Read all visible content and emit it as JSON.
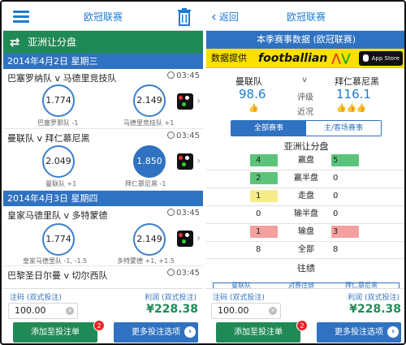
{
  "colors": {
    "brand_blue": "#2f72c1",
    "brand_green": "#208a56",
    "yellow": "#fbe000",
    "red_badge": "#e8262a"
  },
  "left": {
    "nav": {
      "title": "欧冠联赛",
      "menu_icon": "menu-icon",
      "trash_icon": "trash-icon"
    },
    "market": {
      "label": "亚洲让分盘",
      "icon": "swap-icon"
    },
    "dates": [
      "2014年4月2日 星期三",
      "2014年4月3日 星期四"
    ],
    "matches": [
      {
        "name": "巴塞罗纳队 v 马德里竞技队",
        "time": "03:45",
        "home_odds": "1.774",
        "away_odds": "2.149",
        "home_label": "巴塞罗那队 -1",
        "away_label": "马德里竞技队 +1",
        "selected": ""
      },
      {
        "name": "曼联队 v 拜仁慕尼黑",
        "time": "03:45",
        "home_odds": "2.049",
        "away_odds": "1.850",
        "home_label": "曼联队 +1",
        "away_label": "拜仁慕尼黑 -1",
        "selected": "away"
      },
      {
        "name": "皇家马德里队 v 多特蒙德",
        "time": "03:45",
        "home_odds": "1.774",
        "away_odds": "2.149",
        "home_label": "皇家马德里队 -1, -1.5",
        "away_label": "多特蒙德 +1, +1.5",
        "selected": ""
      },
      {
        "name": "巴黎圣日尔曼 v 切尔西队",
        "time": "03:45"
      }
    ],
    "bottom": {
      "stake_label": "注码 (双式投注)",
      "payout_label": "利润 (双式投注)",
      "stake_value": "100.00",
      "payout_value": "¥228.38",
      "add_button": "添加至投注单",
      "badge_count": "2",
      "more_button": "更多投注选项"
    }
  },
  "right": {
    "nav": {
      "back": "返回",
      "title": "欧冠联赛"
    },
    "header_title": "本季赛事数据 (欧冠联赛)",
    "provider": {
      "label": "数据提供",
      "brand": "footballian",
      "app_store": "App Store"
    },
    "teams": {
      "home": "曼联队",
      "vs": "v",
      "away": "拜仁慕尼黑"
    },
    "rating": {
      "home": "98.6",
      "label": "评级",
      "away": "116.1"
    },
    "form": {
      "label": "近况",
      "home": "👍",
      "away": "👍👍👍"
    },
    "tabs": {
      "all": "全部赛事",
      "home_away": "主/客场赛事"
    },
    "handicap": {
      "title": "亚洲让分盘",
      "rows": [
        {
          "label": "赢盘",
          "home": "4",
          "away": "5",
          "home_color": "#5cc47a",
          "away_color": "#5cc47a"
        },
        {
          "label": "赢半盘",
          "home": "2",
          "away": "0",
          "home_color": "#5cc47a",
          "away_color": ""
        },
        {
          "label": "走盘",
          "home": "1",
          "away": "0",
          "home_color": "#f6ec8a",
          "away_color": ""
        },
        {
          "label": "输半盘",
          "home": "0",
          "away": "0",
          "home_color": "",
          "away_color": ""
        },
        {
          "label": "输盘",
          "home": "1",
          "away": "3",
          "home_color": "#f4a0a0",
          "away_color": "#f4a0a0"
        },
        {
          "label": "全部",
          "home": "8",
          "away": "8",
          "home_color": "",
          "away_color": ""
        }
      ]
    },
    "history": {
      "title": "往绩",
      "tabs": [
        "曼联队",
        "对赛往绩",
        "拜仁慕尼黑"
      ]
    },
    "bottom": {
      "stake_label": "注码 (双式投注)",
      "payout_label": "利润 (双式投注)",
      "stake_value": "100.00",
      "payout_value": "¥228.38",
      "add_button": "添加至投注单",
      "badge_count": "2",
      "more_button": "更多投注选项"
    }
  }
}
